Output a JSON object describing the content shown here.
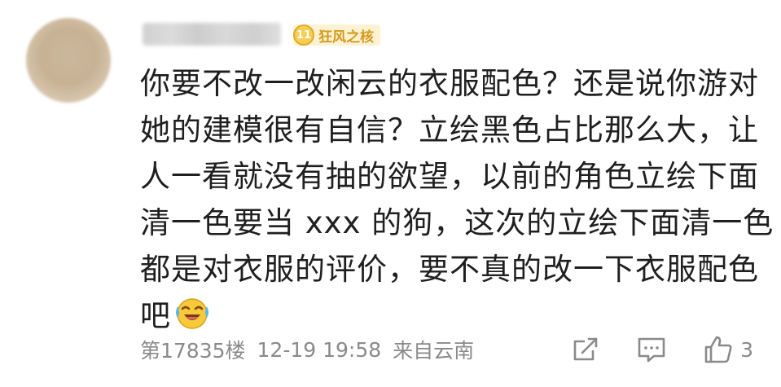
{
  "user": {
    "avatar": "blurred-avatar",
    "level": "11",
    "title": "狂风之核"
  },
  "comment": {
    "lines": [
      "你要不改一改闲云的衣服配色？还是说你游对",
      "她的建模很有自信？立绘黑色占比那么大，让",
      "人一看就没有抽的欲望，以前的角色立绘下面",
      "清一色要当 xxx 的狗，这次的立绘下面清一色",
      "都是对衣服的评价，要不真的改一下衣服配色",
      "吧"
    ],
    "trailing_emoji": "laughing-crying-emoji"
  },
  "meta": {
    "floor": "第17835楼",
    "datetime": "12-19 19:58",
    "location": "来自云南"
  },
  "actions": {
    "share_icon": "share-icon",
    "reply_icon": "reply-icon",
    "like_icon": "thumbs-up-icon",
    "like_count": "3"
  },
  "colors": {
    "text": "#1f1f1f",
    "meta_text": "#8a8a8a",
    "badge_bg": "#fdf2d2",
    "badge_text": "#d59a1e",
    "badge_circle": "#f7cd53"
  }
}
